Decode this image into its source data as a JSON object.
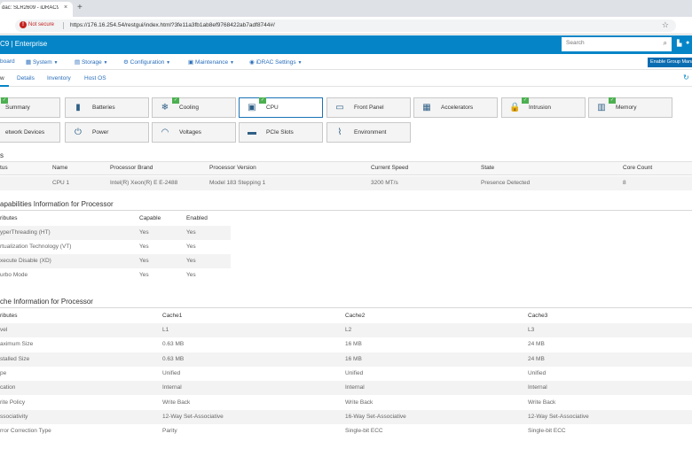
{
  "browser": {
    "tab_title": "dac: SLR2609 - iDRAC9 - Syst",
    "tab_close": "×",
    "new_tab": "+",
    "back_icon": "←",
    "forward_icon": "→",
    "reload_icon": "↻",
    "security_label": "Not secure",
    "url": "https://176.16.254.54/restgui/index.html?3fe11a3fb1ab8ef9768422ab7adf8744#/",
    "star_icon": "☆"
  },
  "header": {
    "brand": "C9 | Enterprise",
    "search_placeholder": "Search"
  },
  "menu": {
    "items": [
      "board",
      "System",
      "Storage",
      "Configuration",
      "Maintenance",
      "iDRAC Settings"
    ],
    "group_button": "Enable Group Manager"
  },
  "subtabs": {
    "items": [
      "w",
      "Details",
      "Inventory",
      "Host OS"
    ]
  },
  "tiles": [
    {
      "label": "Summary",
      "icon": "summary-icon",
      "glyph": "▤"
    },
    {
      "label": "Batteries",
      "icon": "battery-icon",
      "glyph": "▮"
    },
    {
      "label": "Cooling",
      "icon": "fan-icon",
      "glyph": "❄"
    },
    {
      "label": "CPU",
      "icon": "cpu-icon",
      "glyph": "▣"
    },
    {
      "label": "Front Panel",
      "icon": "front-panel-icon",
      "glyph": "▭"
    },
    {
      "label": "Accelerators",
      "icon": "accelerator-icon",
      "glyph": "▦"
    },
    {
      "label": "Intrusion",
      "icon": "lock-icon",
      "glyph": "🔒"
    },
    {
      "label": "Memory",
      "icon": "memory-icon",
      "glyph": "▥"
    },
    {
      "label": "etwork Devices",
      "icon": "network-icon",
      "glyph": "⇆"
    },
    {
      "label": "Power",
      "icon": "power-plug-icon",
      "glyph": "⏻"
    },
    {
      "label": "Voltages",
      "icon": "gauge-icon",
      "glyph": "◠"
    },
    {
      "label": "PCIe Slots",
      "icon": "pcie-icon",
      "glyph": "▬"
    },
    {
      "label": "Environment",
      "icon": "environment-icon",
      "glyph": "⌇"
    }
  ],
  "processors": {
    "title": "s",
    "headers": [
      "tus",
      "Name",
      "Processor Brand",
      "Processor Version",
      "Current Speed",
      "State",
      "Core Count"
    ],
    "rows": [
      [
        "",
        "CPU 1",
        "Intel(R) Xeon(R) E E-2488",
        "Model 183 Stepping 1",
        "3200 MT/s",
        "Presence Detected",
        "8"
      ]
    ]
  },
  "capabilities": {
    "title": "apabilities Information for Processor",
    "headers": [
      "ributes",
      "Capable",
      "Enabled"
    ],
    "rows": [
      [
        "yperThreading (HT)",
        "Yes",
        "Yes"
      ],
      [
        "rtualization Technology (VT)",
        "Yes",
        "Yes"
      ],
      [
        "xecute Disable (XD)",
        "Yes",
        "Yes"
      ],
      [
        "urbo Mode",
        "Yes",
        "Yes"
      ]
    ]
  },
  "cache": {
    "title": "che Information for Processor",
    "headers": [
      "ributes",
      "Cache1",
      "Cache2",
      "Cache3"
    ],
    "rows": [
      [
        "vel",
        "L1",
        "L2",
        "L3"
      ],
      [
        "aximum Size",
        "0.63 MB",
        "16 MB",
        "24 MB"
      ],
      [
        "stalled Size",
        "0.63 MB",
        "16 MB",
        "24 MB"
      ],
      [
        "pe",
        "Unified",
        "Unified",
        "Unified"
      ],
      [
        "cation",
        "Internal",
        "Internal",
        "Internal"
      ],
      [
        "rite Policy",
        "Write Back",
        "Write Back",
        "Write Back"
      ],
      [
        "ssociativity",
        "12-Way Set-Associative",
        "16-Way Set-Associative",
        "12-Way Set-Associative"
      ],
      [
        "rror Correction Type",
        "Parity",
        "Single-bit ECC",
        "Single-bit ECC"
      ]
    ]
  }
}
